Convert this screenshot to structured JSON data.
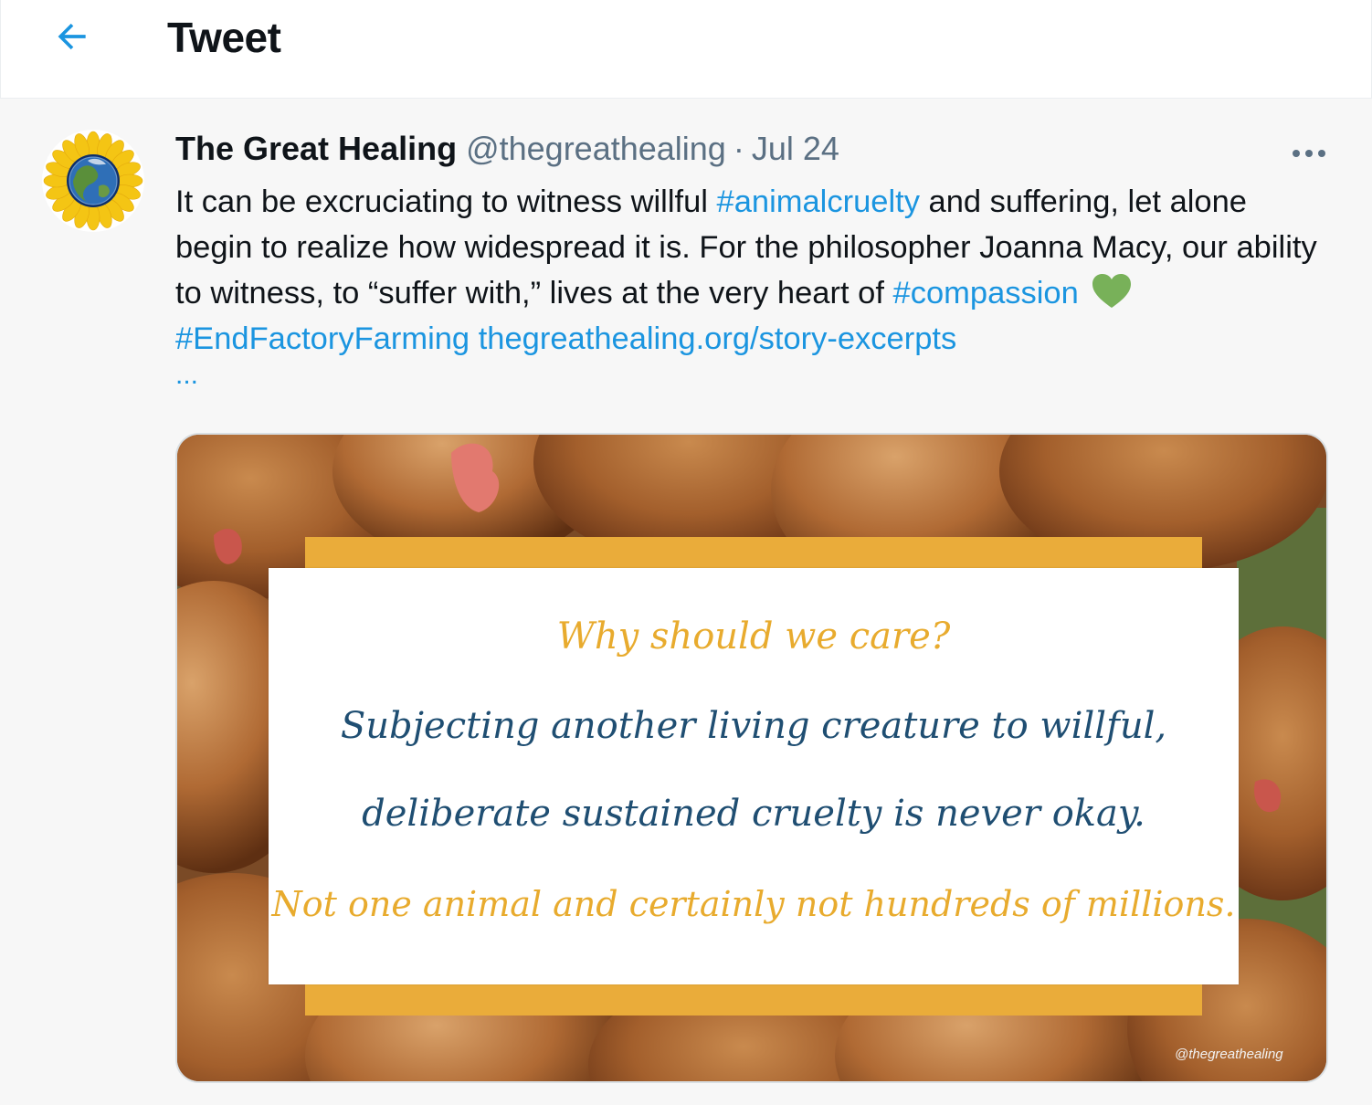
{
  "header": {
    "title": "Tweet",
    "back_icon": "arrow-left-icon"
  },
  "tweet": {
    "author": {
      "display_name": "The Great Healing",
      "handle": "@thegreathealing",
      "avatar_icon": "sunflower-earth-avatar"
    },
    "separator": "·",
    "date": "Jul 24",
    "more_icon": "more-horizontal-icon",
    "text": {
      "part1": "It can be excruciating to witness willful ",
      "hashtag1": "#animalcruelty",
      "part2": " and suffering, let alone begin to realize how widespread it is. For the philosopher Joanna Macy, our ability to witness, to “suffer with,” lives at the very heart of ",
      "hashtag2": "#compassion",
      "heart_icon": "green-heart-icon",
      "hashtag3": "#EndFactoryFarming",
      "link": "thegreathealing.org/story-excerpts",
      "ellipsis": "..."
    },
    "media": {
      "quote_line1": "Why should we care?",
      "quote_line2": "Subjecting another living creature to willful,",
      "quote_line3": "deliberate sustained cruelty is never okay.",
      "quote_line4": "Not one animal and certainly not hundreds of millions.",
      "watermark": "@thegreathealing",
      "colors": {
        "gold": "#e8ab2e",
        "navy": "#1f4e72",
        "frame": "#eaac3a"
      }
    }
  },
  "colors": {
    "link_blue": "#1b95e0",
    "text_dark": "#0f1419",
    "text_muted": "#5b7083",
    "background": "#f7f7f7"
  }
}
